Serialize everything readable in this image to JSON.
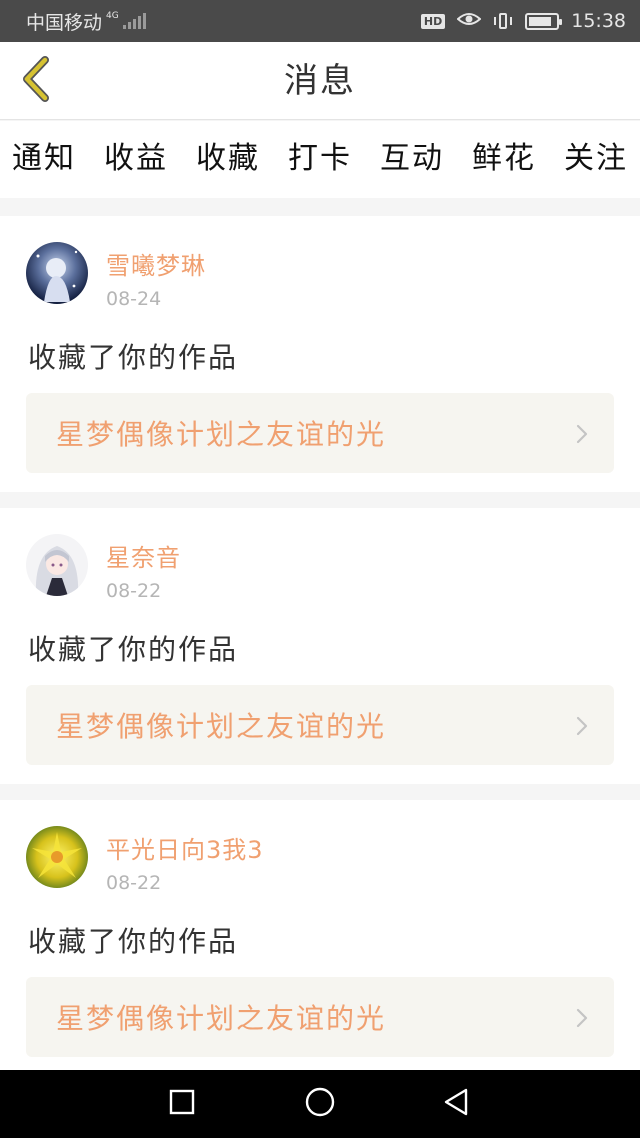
{
  "status_bar": {
    "carrier": "中国移动",
    "network": "4G",
    "time": "15:38",
    "hd_badge": "HD",
    "battery_level": 0.85
  },
  "header": {
    "title": "消息",
    "back_icon": "chevron-left-icon"
  },
  "tabs": [
    {
      "label": "通知",
      "active": false
    },
    {
      "label": "收益",
      "active": false
    },
    {
      "label": "收藏",
      "active": true
    },
    {
      "label": "打卡",
      "active": false
    },
    {
      "label": "互动",
      "active": false
    },
    {
      "label": "鲜花",
      "active": false
    },
    {
      "label": "关注",
      "active": false
    }
  ],
  "messages": [
    {
      "username": "雪曦梦琳",
      "date": "08-24",
      "action": "收藏了你的作品",
      "work_title": "星梦偶像计划之友谊的光"
    },
    {
      "username": "星奈音",
      "date": "08-22",
      "action": "收藏了你的作品",
      "work_title": "星梦偶像计划之友谊的光"
    },
    {
      "username": "平光日向3我3",
      "date": "08-22",
      "action": "收藏了你的作品",
      "work_title": "星梦偶像计划之友谊的光"
    }
  ],
  "colors": {
    "accent_pink": "#e16aa8",
    "accent_orange": "#f0a070",
    "back_yellow": "#c9b52e"
  },
  "nav_bar": {
    "icons": [
      "square-icon",
      "circle-icon",
      "triangle-back-icon"
    ]
  }
}
